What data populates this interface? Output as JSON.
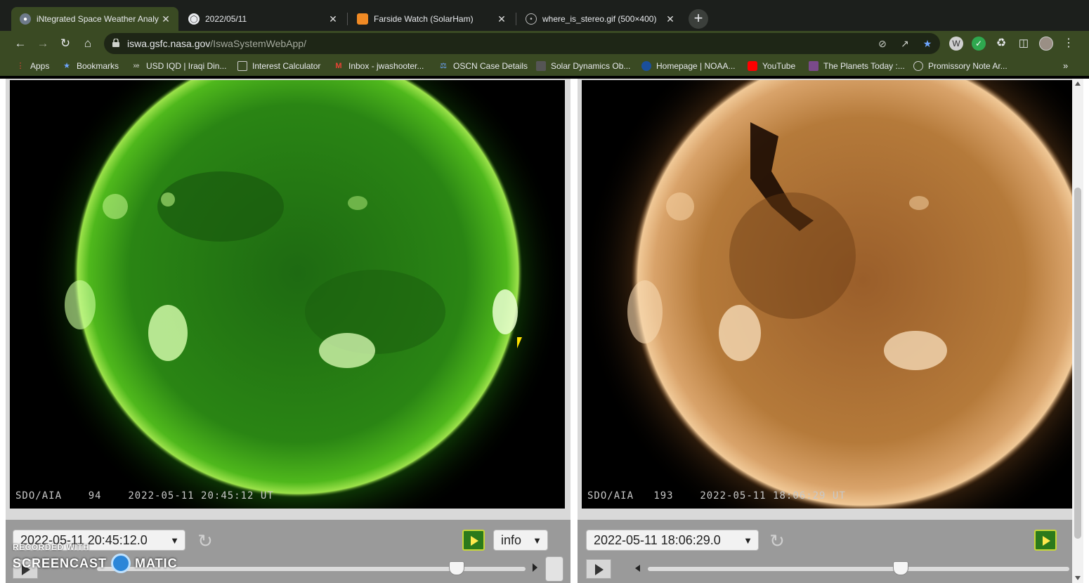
{
  "tabs": [
    {
      "title": "iNtegrated Space Weather Analy",
      "icon": "satellite-icon",
      "active": true
    },
    {
      "title": "2022/05/11",
      "icon": "globe-icon",
      "active": false
    },
    {
      "title": "Farside Watch (SolarHam)",
      "icon": "solarham-icon",
      "active": false
    },
    {
      "title": "where_is_stereo.gif (500×400)",
      "icon": "image-icon",
      "active": false
    }
  ],
  "toolbar": {
    "url_host": "iswa.gsfc.nasa.gov",
    "url_path": "/IswaSystemWebApp/"
  },
  "bookmarks": [
    {
      "label": "Apps",
      "icon": "apps-grid-icon"
    },
    {
      "label": "Bookmarks",
      "icon": "star-icon"
    },
    {
      "label": "USD IQD | Iraqi Din...",
      "icon": "currency-icon"
    },
    {
      "label": "Interest Calculator",
      "icon": "calculator-icon"
    },
    {
      "label": "Inbox - jwashooter...",
      "icon": "gmail-icon"
    },
    {
      "label": "OSCN Case Details",
      "icon": "scales-icon"
    },
    {
      "label": "Solar Dynamics Ob...",
      "icon": "sdo-icon"
    },
    {
      "label": "Homepage | NOAA...",
      "icon": "noaa-icon"
    },
    {
      "label": "YouTube",
      "icon": "youtube-icon"
    },
    {
      "label": "The Planets Today :...",
      "icon": "planets-icon"
    },
    {
      "label": "Promissory Note Ar...",
      "icon": "document-icon"
    }
  ],
  "panels": {
    "left": {
      "label_instrument": "SDO/AIA",
      "label_wavelength": "94",
      "label_time": "2022-05-11 20:45:12 UT",
      "date_value": "2022-05-11 20:45:12.0",
      "info_label": "info",
      "slider_position": 0.84
    },
    "right": {
      "label_instrument": "SDO/AIA",
      "label_wavelength": "193",
      "label_time": "2022-05-11 18:06:29 UT",
      "date_value": "2022-05-11 18:06:29.0",
      "slider_position": 0.6
    }
  },
  "watermark": {
    "recorded_with": "RECORDED WITH",
    "brand_left": "SCREENCAST",
    "brand_right": "MATIC"
  },
  "colors": {
    "accent_tab": "#3a4a23",
    "sun_94": "#39a30f",
    "sun_193": "#b57a3a"
  }
}
